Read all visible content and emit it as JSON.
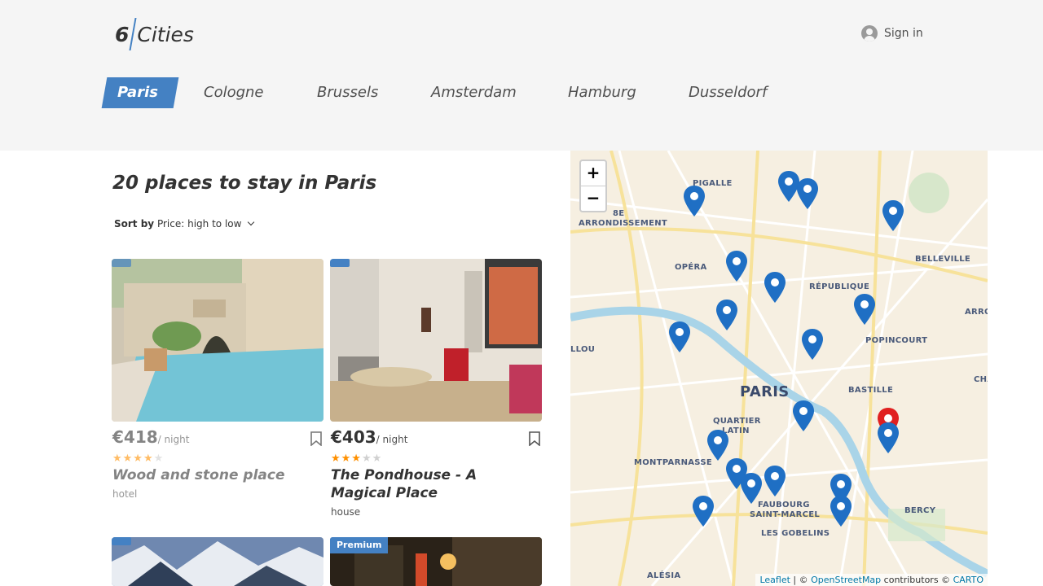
{
  "header": {
    "logo_number": "6",
    "logo_text": "Cities",
    "signin_label": "Sign in"
  },
  "tabs": [
    {
      "label": "Paris",
      "active": true
    },
    {
      "label": "Cologne",
      "active": false
    },
    {
      "label": "Brussels",
      "active": false
    },
    {
      "label": "Amsterdam",
      "active": false
    },
    {
      "label": "Hamburg",
      "active": false
    },
    {
      "label": "Dusseldorf",
      "active": false
    }
  ],
  "places": {
    "title": "20 places to stay in Paris",
    "sort_label": "Sort by",
    "sort_value": "Price: high to low"
  },
  "cards": [
    {
      "price": "€418",
      "per": "/ night",
      "rating": 4,
      "name": "Wood and stone place",
      "type": "hotel",
      "premium": false
    },
    {
      "price": "€403",
      "per": "/ night",
      "rating": 3,
      "name": "The Pondhouse - A Magical Place",
      "type": "house",
      "premium": false
    },
    {
      "premium": false
    },
    {
      "premium": true,
      "premium_label": "Premium"
    }
  ],
  "map": {
    "zoom_in": "+",
    "zoom_out": "−",
    "labels": [
      "PIGALLE",
      "8E",
      "ARRONDISSEMENT",
      "OPÉRA",
      "RÉPUBLIQUE",
      "BELLEVILLE",
      "ARRO",
      "LLOU",
      "POPINCOURT",
      "PARIS",
      "BASTILLE",
      "CHA",
      "QUARTIER",
      "LATIN",
      "MONTPARNASSE",
      "FAUBOURG",
      "SAINT-MARCEL",
      "BERCY",
      "LES GOBELINS",
      "ALÉSIA"
    ],
    "attribution": {
      "leaflet": "Leaflet",
      "sep": " | © ",
      "osm": "OpenStreetMap",
      "contrib": " contributors © ",
      "carto": "CARTO"
    }
  },
  "colors": {
    "accent": "#4481c3",
    "star": "#ff9000",
    "pin": "#1f6fc4",
    "pin_active": "#e02020"
  }
}
